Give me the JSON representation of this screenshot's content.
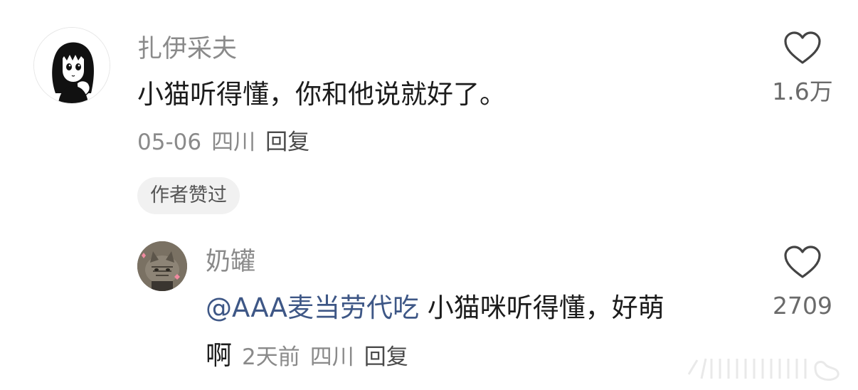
{
  "comment": {
    "username": "扎伊采夫",
    "text": "小猫听得懂，你和他说就好了。",
    "date": "05-06",
    "location": "四川",
    "reply_label": "回复",
    "like_count": "1.6万",
    "author_liked_badge": "作者赞过",
    "avatar_icon": "anime-girl-avatar",
    "like_icon": "heart-outline-icon"
  },
  "reply": {
    "username": "奶罐",
    "mention": "@AAA麦当劳代吃",
    "text_line1": " 小猫咪听得懂，好萌",
    "text_line2": "啊",
    "date": "2天前",
    "location": "四川",
    "reply_label": "回复",
    "like_count": "2709",
    "avatar_icon": "cat-avatar",
    "like_icon": "heart-outline-icon"
  },
  "colors": {
    "username": "#8a8a8a",
    "text": "#1c1c1c",
    "mention": "#3e5786",
    "meta": "#8a8a8a",
    "badge_bg": "#f1f1f1"
  }
}
